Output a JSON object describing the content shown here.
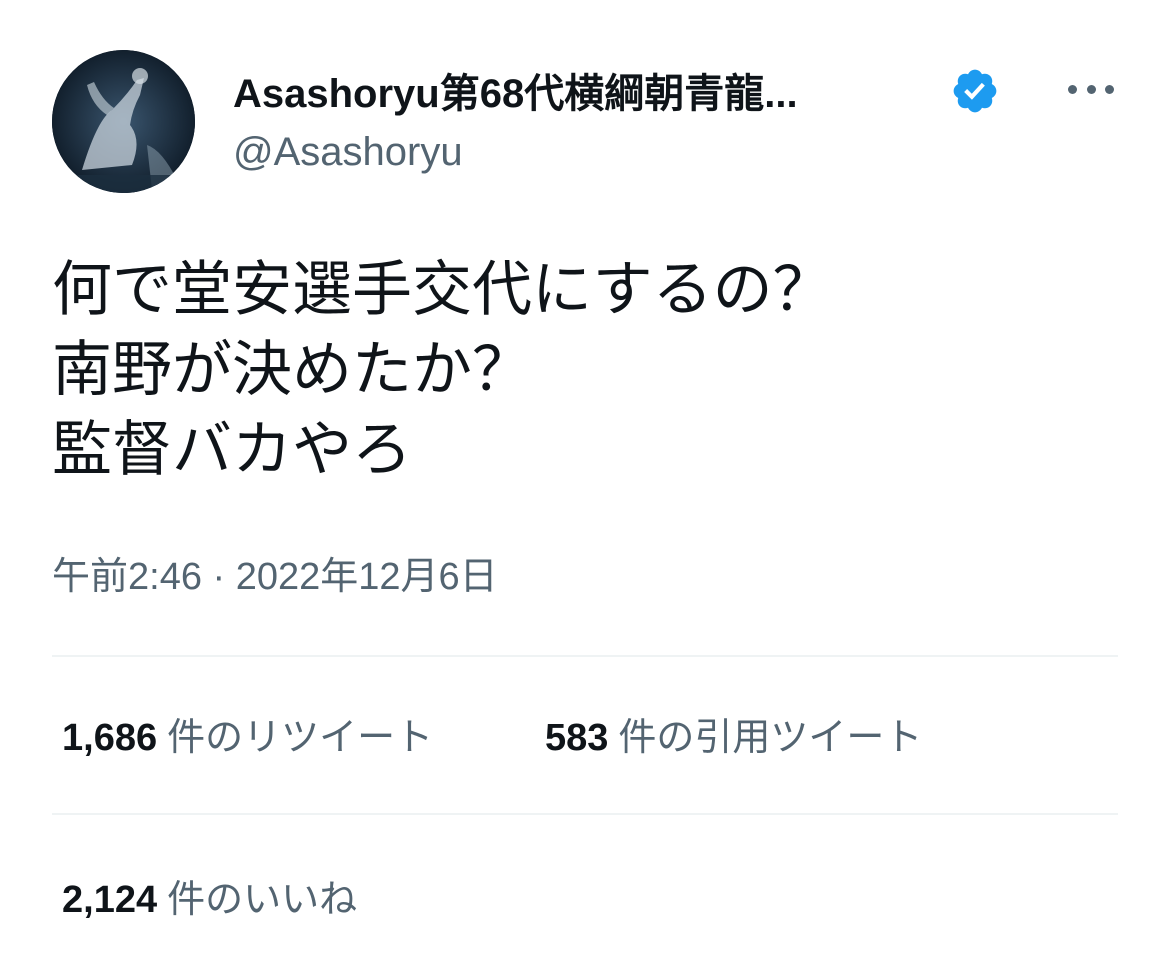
{
  "author": {
    "display_name": "Asashoryu第68代横綱朝青龍...",
    "handle": "@Asashoryu",
    "verified": true,
    "avatar_icon": "avatar-photo",
    "verified_icon": "verified-badge-icon",
    "more_icon": "more-options-icon"
  },
  "tweet": {
    "lines": [
      "何で堂安選手交代にするの？",
      "南野が決めたか？",
      "監督バカやろ"
    ],
    "timestamp": "午前2:46 · 2022年12月6日"
  },
  "stats": {
    "retweets": {
      "count": "1,686",
      "label": "件のリツイート"
    },
    "quotes": {
      "count": "583",
      "label": "件の引用ツイート"
    },
    "likes": {
      "count": "2,124",
      "label": "件のいいね"
    }
  },
  "colors": {
    "text_primary": "#0f1419",
    "text_secondary": "#536471",
    "verified_blue": "#1d9bf0",
    "divider": "#eff3f4"
  }
}
